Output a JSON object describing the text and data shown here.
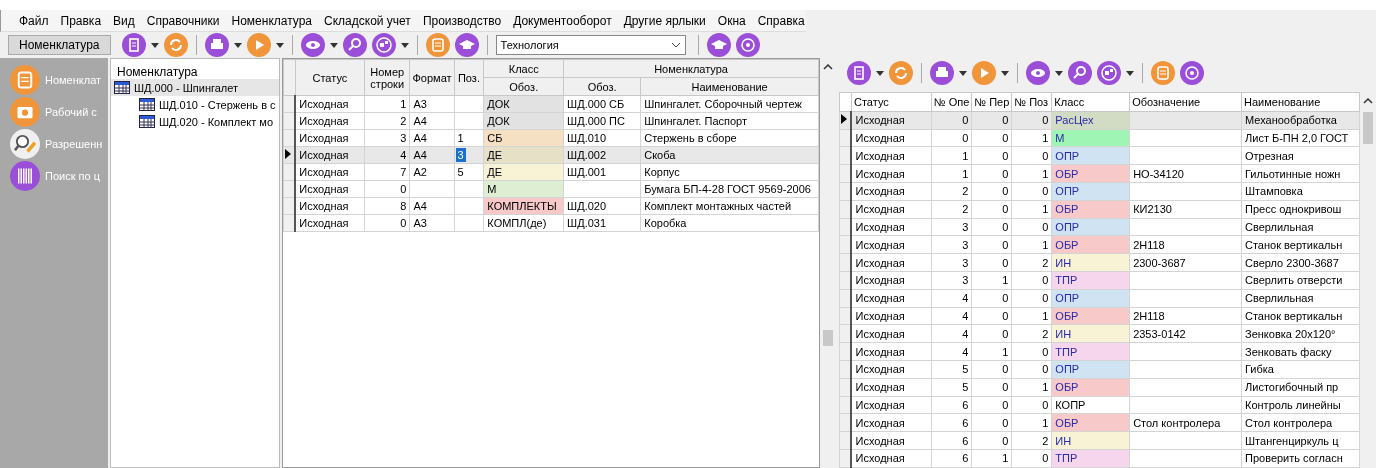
{
  "menu": [
    "Файл",
    "Правка",
    "Вид",
    "Справочники",
    "Номенклатура",
    "Складской учет",
    "Производство",
    "Документооборот",
    "Другие ярлыки",
    "Окна",
    "Справка"
  ],
  "toolbar": {
    "tab": "Номенклатура",
    "combo": "Технология"
  },
  "sidebar": {
    "items": [
      {
        "label": "Номенклат",
        "kind": "scroll"
      },
      {
        "label": "Рабочий с",
        "kind": "camera"
      },
      {
        "label": "Разрешенн",
        "kind": "magnifier"
      },
      {
        "label": "Поиск по ц",
        "kind": "barcode"
      }
    ]
  },
  "tree": {
    "title": "Номенклатура",
    "items": [
      {
        "label": "ШД.000 - Шпингалет",
        "selected": true,
        "children": [
          {
            "label": "ШД.010 - Стержень в с",
            "selected": false
          },
          {
            "label": "ШД.020 - Комплект мо",
            "selected": false
          }
        ]
      }
    ]
  },
  "spec_table": {
    "group_headers": [
      "Класс",
      "Номенклатура"
    ],
    "columns": [
      "Статус",
      "Номер строки",
      "Формат",
      "Поз.",
      "Обоз.",
      "Обоз.",
      "Наименование"
    ],
    "rows": [
      {
        "cells": [
          "Исходная",
          "1",
          "А3",
          "",
          "ДОК",
          "ШД.000 СБ",
          "Шпингалет. Сборочный чертеж"
        ],
        "color": "#e2e2e2",
        "selected": false
      },
      {
        "cells": [
          "Исходная",
          "2",
          "А4",
          "",
          "ДОК",
          "ШД.000 ПС",
          "Шпингалет. Паспорт"
        ],
        "color": "#e2e2e2",
        "selected": false
      },
      {
        "cells": [
          "Исходная",
          "3",
          "А4",
          "1",
          "СБ",
          "ШД.010",
          "Стержень в сборе"
        ],
        "color": "#f6e0c4",
        "selected": false
      },
      {
        "cells": [
          "Исходная",
          "4",
          "А4",
          "3",
          "ДЕ",
          "ШД.002",
          "Скоба"
        ],
        "color": "#e6e0c6",
        "selected": true
      },
      {
        "cells": [
          "Исходная",
          "7",
          "А2",
          "5",
          "ДЕ",
          "ШД.001",
          "Корпус"
        ],
        "color": "#f8f3d4",
        "selected": false
      },
      {
        "cells": [
          "Исходная",
          "0",
          "",
          "",
          "М",
          "",
          "Бумага БП-4-28 ГОСТ 9569-2006"
        ],
        "color": "#deeed3",
        "selected": false
      },
      {
        "cells": [
          "Исходная",
          "8",
          "А4",
          "",
          "КОМПЛЕКТЫ",
          "ШД.020",
          "Комплект монтажных частей"
        ],
        "color": "#f8c9c9",
        "selected": false
      },
      {
        "cells": [
          "Исходная",
          "0",
          "А3",
          "",
          "КОМПЛ(де)",
          "ШД.031",
          "Коробка"
        ],
        "selected": false
      }
    ]
  },
  "tech_table": {
    "columns": [
      "Статус",
      "№ Опе",
      "№ Пер",
      "№ Поз",
      "Класс",
      "Обозначение",
      "Наименование"
    ],
    "rows": [
      {
        "cells": [
          "Исходная",
          "0",
          "0",
          "0",
          "РасЦех",
          "",
          "Механообработка"
        ],
        "color": "#d2dcc4",
        "selected": true
      },
      {
        "cells": [
          "Исходная",
          "0",
          "0",
          "1",
          "М",
          "",
          "Лист Б-ПН 2,0 ГОСТ"
        ],
        "color": "#9ef5b4",
        "selected": false
      },
      {
        "cells": [
          "Исходная",
          "1",
          "0",
          "0",
          "ОПР",
          "",
          "Отрезная"
        ],
        "color": "#cfe3f3",
        "selected": false
      },
      {
        "cells": [
          "Исходная",
          "1",
          "0",
          "1",
          "ОБР",
          "НО-34120",
          "Гильотинные ножн"
        ],
        "color": "#f8c9c9",
        "selected": false
      },
      {
        "cells": [
          "Исходная",
          "2",
          "0",
          "0",
          "ОПР",
          "",
          "Штамповка"
        ],
        "color": "#cfe3f3",
        "selected": false
      },
      {
        "cells": [
          "Исходная",
          "2",
          "0",
          "1",
          "ОБР",
          "КИ2130",
          "Пресс однокривош"
        ],
        "color": "#f8c9c9",
        "selected": false
      },
      {
        "cells": [
          "Исходная",
          "3",
          "0",
          "0",
          "ОПР",
          "",
          "Сверлильная"
        ],
        "color": "#cfe3f3",
        "selected": false
      },
      {
        "cells": [
          "Исходная",
          "3",
          "0",
          "1",
          "ОБР",
          "2Н118",
          "Станок вертикальн"
        ],
        "color": "#f8c9c9",
        "selected": false
      },
      {
        "cells": [
          "Исходная",
          "3",
          "0",
          "2",
          "ИН",
          "2300-3687",
          "Сверло 2300-3687"
        ],
        "color": "#f8f3d4",
        "selected": false
      },
      {
        "cells": [
          "Исходная",
          "3",
          "1",
          "0",
          "ТПР",
          "",
          "Сверлить отверсти"
        ],
        "color": "#f6d6ec",
        "selected": false
      },
      {
        "cells": [
          "Исходная",
          "4",
          "0",
          "0",
          "ОПР",
          "",
          "Сверлильная"
        ],
        "color": "#cfe3f3",
        "selected": false
      },
      {
        "cells": [
          "Исходная",
          "4",
          "0",
          "1",
          "ОБР",
          "2Н118",
          "Станок вертикальн"
        ],
        "color": "#f8c9c9",
        "selected": false
      },
      {
        "cells": [
          "Исходная",
          "4",
          "0",
          "2",
          "ИН",
          "2353-0142",
          "Зенковка  20х120°"
        ],
        "color": "#f8f3d4",
        "selected": false
      },
      {
        "cells": [
          "Исходная",
          "4",
          "1",
          "0",
          "ТПР",
          "",
          "Зенковать фаску"
        ],
        "color": "#f6d6ec",
        "selected": false
      },
      {
        "cells": [
          "Исходная",
          "5",
          "0",
          "0",
          "ОПР",
          "",
          "Гибка"
        ],
        "color": "#cfe3f3",
        "selected": false
      },
      {
        "cells": [
          "Исходная",
          "5",
          "0",
          "1",
          "ОБР",
          "",
          "Листогибочный пр"
        ],
        "color": "#f8c9c9",
        "selected": false
      },
      {
        "cells": [
          "Исходная",
          "6",
          "0",
          "0",
          "КОПР",
          "",
          "Контроль линейны"
        ],
        "selected": false
      },
      {
        "cells": [
          "Исходная",
          "6",
          "0",
          "1",
          "ОБР",
          "Стол контролера",
          "Стол контролера"
        ],
        "color": "#f8c9c9",
        "selected": false
      },
      {
        "cells": [
          "Исходная",
          "6",
          "0",
          "2",
          "ИН",
          "",
          "Штангенциркуль ц"
        ],
        "color": "#f8f3d4",
        "selected": false
      },
      {
        "cells": [
          "Исходная",
          "6",
          "1",
          "0",
          "ТПР",
          "",
          "Проверить согласн"
        ],
        "color": "#f6d6ec",
        "selected": false
      }
    ]
  }
}
